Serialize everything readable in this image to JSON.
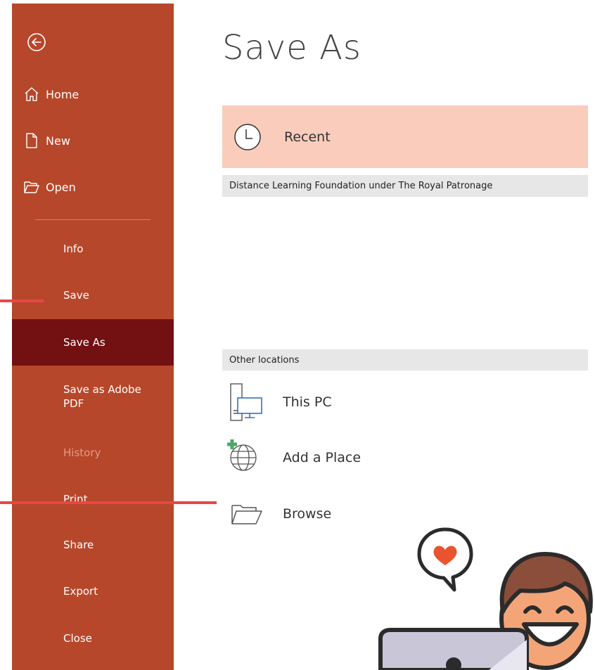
{
  "sidebar": {
    "top_items": [
      {
        "label": "Home",
        "icon": "home-icon"
      },
      {
        "label": "New",
        "icon": "new-document-icon"
      },
      {
        "label": "Open",
        "icon": "open-folder-icon"
      }
    ],
    "items": [
      {
        "label": "Info"
      },
      {
        "label": "Save"
      },
      {
        "label": "Save As"
      },
      {
        "label": "Save as Adobe PDF"
      },
      {
        "label": "History"
      },
      {
        "label": "Print"
      },
      {
        "label": "Share"
      },
      {
        "label": "Export"
      },
      {
        "label": "Close"
      }
    ],
    "active_item": "Save As",
    "disabled_items": [
      "History"
    ],
    "color": "#B7472A",
    "active_color": "#731012"
  },
  "main": {
    "title": "Save As",
    "recent_label": "Recent",
    "recent_bg": "#F9CCBC",
    "recent_group_header": "Distance Learning Foundation under The Royal Patronage",
    "other_locations_header": "Other locations",
    "locations": [
      {
        "label": "This PC",
        "icon": "this-pc-icon"
      },
      {
        "label": "Add a Place",
        "icon": "add-place-globe-icon"
      },
      {
        "label": "Browse",
        "icon": "browse-folder-icon"
      }
    ]
  },
  "annotations": {
    "pointer_color": "#E74747"
  }
}
